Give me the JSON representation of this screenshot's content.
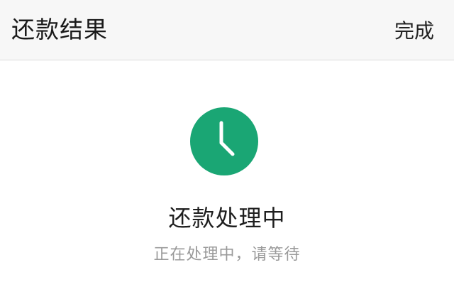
{
  "header": {
    "title": "还款结果",
    "done_label": "完成"
  },
  "status": {
    "icon": "clock-icon",
    "icon_color": "#1aa674",
    "title": "还款处理中",
    "subtitle": "正在处理中，请等待"
  }
}
